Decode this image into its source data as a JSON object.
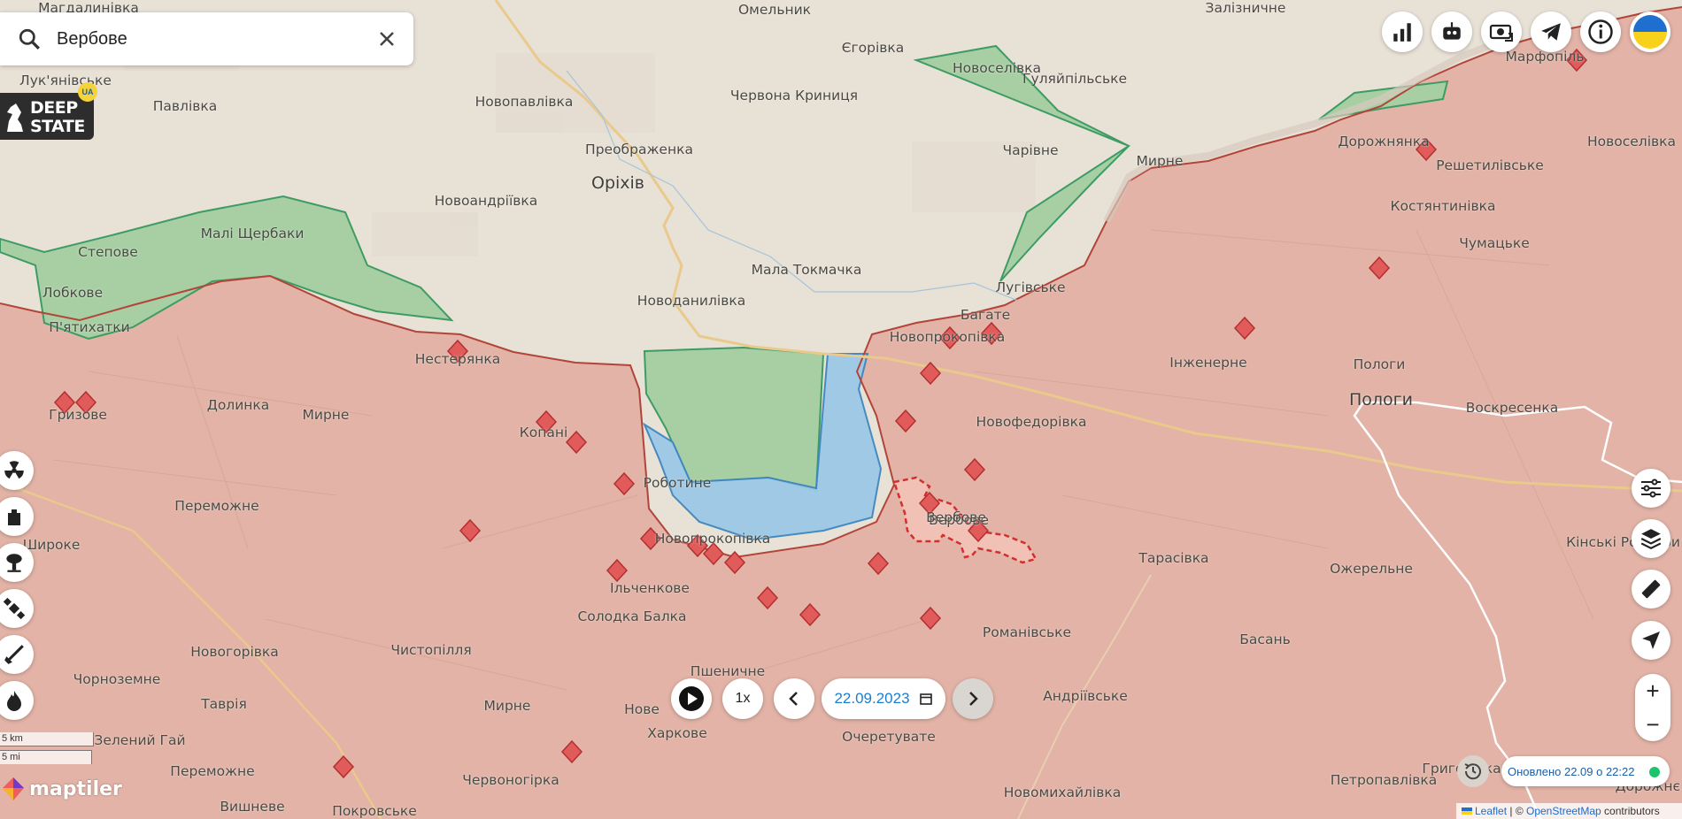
{
  "search": {
    "value": "Вербове"
  },
  "logo": {
    "line1": "DEEP",
    "line2": "STATE",
    "badge": "UA"
  },
  "places": [
    {
      "name": "Магдалинівка",
      "cls": ""
    },
    {
      "name": "Омельник",
      "cls": ""
    },
    {
      "name": "Залізничне",
      "cls": ""
    },
    {
      "name": "Лук'янівське",
      "cls": ""
    },
    {
      "name": "Павлівка",
      "cls": ""
    },
    {
      "name": "Новопавлівка",
      "cls": ""
    },
    {
      "name": "Єгорівка",
      "cls": ""
    },
    {
      "name": "Новоселівка",
      "cls": ""
    },
    {
      "name": "Гуляйпільське",
      "cls": ""
    },
    {
      "name": "Червона Криниця",
      "cls": ""
    },
    {
      "name": "Преображенка",
      "cls": ""
    },
    {
      "name": "Оріхів",
      "cls": "big"
    },
    {
      "name": "Чарівне",
      "cls": ""
    },
    {
      "name": "Мирне",
      "cls": ""
    },
    {
      "name": "Марфопіль",
      "cls": ""
    },
    {
      "name": "Дорожнянка",
      "cls": ""
    },
    {
      "name": "Новоселівка",
      "cls": ""
    },
    {
      "name": "Решетилівське",
      "cls": ""
    },
    {
      "name": "Новоандріївка",
      "cls": ""
    },
    {
      "name": "Костянтинівка",
      "cls": ""
    },
    {
      "name": "Малі Щербаки",
      "cls": ""
    },
    {
      "name": "Степове",
      "cls": ""
    },
    {
      "name": "Чумацьке",
      "cls": ""
    },
    {
      "name": "Мала Токмачка",
      "cls": ""
    },
    {
      "name": "Лобкове",
      "cls": ""
    },
    {
      "name": "Новоданилівка",
      "cls": ""
    },
    {
      "name": "Лугівське",
      "cls": ""
    },
    {
      "name": "П'ятихатки",
      "cls": ""
    },
    {
      "name": "Багате",
      "cls": ""
    },
    {
      "name": "Новопрокопівка",
      "cls": ""
    },
    {
      "name": "Нестерянка",
      "cls": ""
    },
    {
      "name": "Інженерне",
      "cls": ""
    },
    {
      "name": "Пологи",
      "cls": ""
    },
    {
      "name": "Пологи",
      "cls": "big"
    },
    {
      "name": "Долинка",
      "cls": ""
    },
    {
      "name": "Мирне",
      "cls": ""
    },
    {
      "name": "Гризове",
      "cls": ""
    },
    {
      "name": "Копані",
      "cls": ""
    },
    {
      "name": "Новофедорівка",
      "cls": ""
    },
    {
      "name": "Воскресенка",
      "cls": ""
    },
    {
      "name": "Роботине",
      "cls": ""
    },
    {
      "name": "Переможне",
      "cls": ""
    },
    {
      "name": "Вербове",
      "cls": ""
    },
    {
      "name": "Широке",
      "cls": ""
    },
    {
      "name": "Новопрокопівка",
      "cls": ""
    },
    {
      "name": "Тарасівка",
      "cls": ""
    },
    {
      "name": "Ожерельне",
      "cls": ""
    },
    {
      "name": "Кінські Роздори",
      "cls": ""
    },
    {
      "name": "Ільченкове",
      "cls": ""
    },
    {
      "name": "Солодка Балка",
      "cls": ""
    },
    {
      "name": "Романівське",
      "cls": ""
    },
    {
      "name": "Басань",
      "cls": ""
    },
    {
      "name": "Новогорівка",
      "cls": ""
    },
    {
      "name": "Чистопілля",
      "cls": ""
    },
    {
      "name": "Пшеничне",
      "cls": ""
    },
    {
      "name": "Вербове",
      "cls": ""
    },
    {
      "name": "Чорноземне",
      "cls": ""
    },
    {
      "name": "Таврія",
      "cls": ""
    },
    {
      "name": "Мирне",
      "cls": ""
    },
    {
      "name": "Нове",
      "cls": ""
    },
    {
      "name": "Андріївське",
      "cls": ""
    },
    {
      "name": "Харкове",
      "cls": ""
    },
    {
      "name": "Зелений Гай",
      "cls": ""
    },
    {
      "name": "Очеретувате",
      "cls": ""
    },
    {
      "name": "Переможне",
      "cls": ""
    },
    {
      "name": "Червоногірка",
      "cls": ""
    },
    {
      "name": "Григорівка",
      "cls": ""
    },
    {
      "name": "Петропавлівка",
      "cls": ""
    },
    {
      "name": "Новомихайлівка",
      "cls": ""
    },
    {
      "name": "Вишневе",
      "cls": ""
    },
    {
      "name": "Покровське",
      "cls": ""
    },
    {
      "name": "Дорожнє",
      "cls": ""
    }
  ],
  "playback": {
    "speed": "1x",
    "date": "22.09.2023"
  },
  "status": {
    "updated": "Оновлено 22.09 о 22:22"
  },
  "scale": {
    "km": "5 km",
    "mi": "5 mi"
  },
  "maptiler": "maptiler",
  "attribution": {
    "leaflet": "Leaflet",
    "sep": " | © ",
    "osm": "OpenStreetMap",
    "tail": " contributors"
  },
  "colors": {
    "occupied": "#e2b3a6",
    "liberated": "#a8cfa3",
    "contested_blue": "#9dc8e6",
    "front": "#b2453a",
    "accent": "#1a7fd4"
  },
  "icons": [
    "search-icon",
    "close-icon",
    "chart-icon",
    "robot-icon",
    "donate-icon",
    "telegram-icon",
    "info-icon",
    "ukraine-flag-icon",
    "nuclear-icon",
    "fortification-icon",
    "explosion-icon",
    "satellite-icon",
    "missile-icon",
    "fire-icon",
    "filter-icon",
    "layers-icon",
    "ruler-icon",
    "locate-icon",
    "play-icon",
    "chevron-left-icon",
    "calendar-icon",
    "chevron-right-icon",
    "history-icon"
  ]
}
